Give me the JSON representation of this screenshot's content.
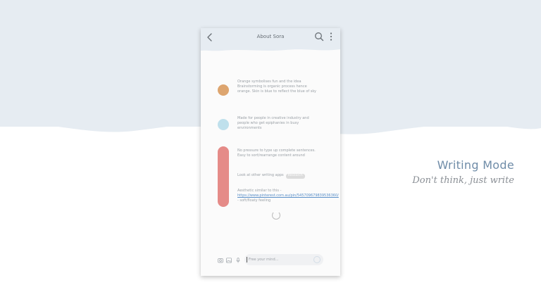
{
  "colors": {
    "background_top": "#e6ecf2",
    "background_bottom": "#ffffff",
    "accent_orange": "#dda56f",
    "accent_blue": "#bfe0ec",
    "accent_red": "#e58b88",
    "headline": "#6f8ca8"
  },
  "app": {
    "title": "About Sora",
    "icons": {
      "back": "chevron-left-icon",
      "search": "search-icon",
      "more": "more-vertical-icon"
    }
  },
  "notes": [
    {
      "text": "Orange symbolises fun and the idea Brainstorming is organic process hence orange. Skin is blue to reflect the blue of sky"
    },
    {
      "text": "Made for people in creative industry and people who get epiphanies in busy environments"
    },
    {
      "text": "No pressure to type up complete sentences. Easy to sort/rearrange content around"
    },
    {
      "text": "Look at other writing apps",
      "tag": "Research"
    },
    {
      "text_before": "Aesthetic similar to this - ",
      "link": "https://www.pinterest.com.au/pin/545709679839536360/",
      "text_after": " - soft/floaty feeling"
    }
  ],
  "composer": {
    "placeholder": "Free your mind...",
    "icons": [
      "camera-icon",
      "image-icon",
      "microphone-icon",
      "send-icon"
    ]
  },
  "headline": "Writing Mode",
  "subheadline": "Don't think, just write"
}
